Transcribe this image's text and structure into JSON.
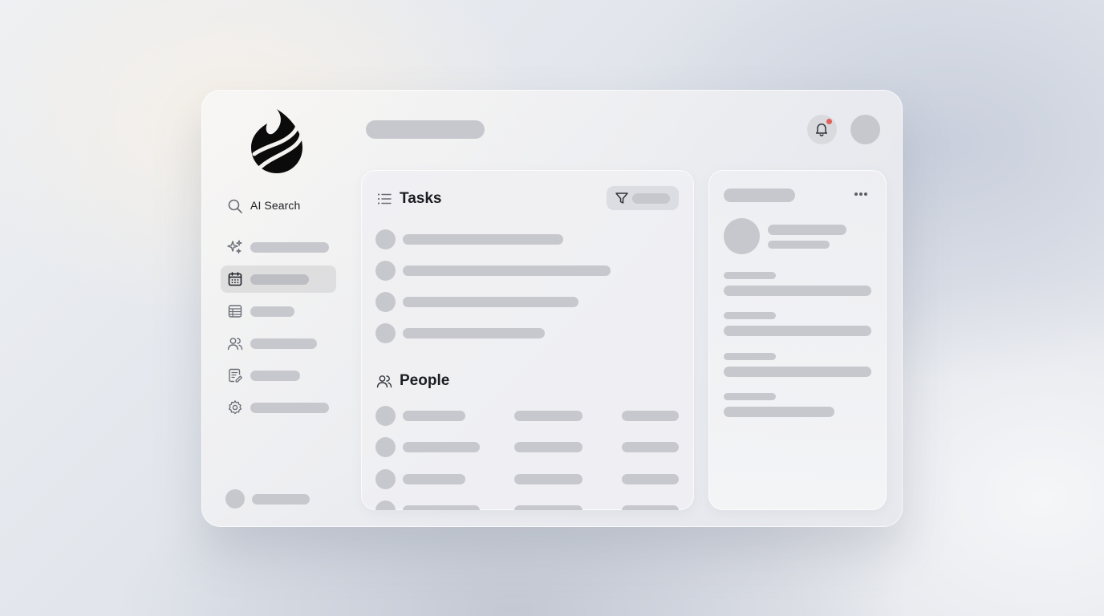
{
  "sidebar": {
    "search_label": "AI Search"
  },
  "main": {
    "tasks_title": "Tasks",
    "people_title": "People"
  },
  "colors": {
    "accent_dot": "#e2605a",
    "skeleton": "#c7c8cd"
  },
  "icons": {
    "logo": "flame-logo",
    "search": "search-icon",
    "nav": [
      "sparkles-icon",
      "calendar-icon",
      "table-icon",
      "users-icon",
      "notes-icon",
      "gear-icon"
    ],
    "tasks": "list-icon",
    "people": "users-icon",
    "filter": "filter-icon",
    "notifications": "bell-icon",
    "menu": "more-horizontal-icon"
  }
}
